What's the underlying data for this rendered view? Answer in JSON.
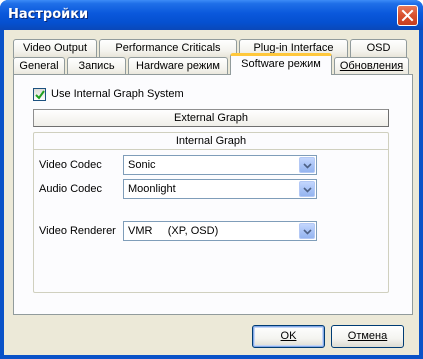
{
  "window": {
    "title": "Настройки"
  },
  "tabs_row1": [
    {
      "label": "Video Output"
    },
    {
      "label": "Performance Criticals"
    },
    {
      "label": "Plug-in Interface"
    },
    {
      "label": "OSD"
    }
  ],
  "tabs_row2": [
    {
      "label": "General"
    },
    {
      "label": "Запись"
    },
    {
      "label": "Hardware режим"
    },
    {
      "label": "Software режим"
    },
    {
      "label": "Обновления"
    }
  ],
  "panel": {
    "use_internal_label": "Use Internal Graph System",
    "use_internal_checked": true,
    "external_graph_label": "External Graph",
    "internal_graph_title": "Internal Graph",
    "video_codec": {
      "label": "Video Codec",
      "value": "Sonic"
    },
    "audio_codec": {
      "label": "Audio Codec",
      "value": "Moonlight"
    },
    "video_renderer": {
      "label": "Video Renderer",
      "value": "VMR     (XP, OSD)"
    }
  },
  "buttons": {
    "ok": "OK",
    "cancel": "Отмена"
  },
  "colors": {
    "titlebar": "#0a58dc",
    "face": "#ece9d8",
    "active_tab_accent": "#ffc83c"
  }
}
